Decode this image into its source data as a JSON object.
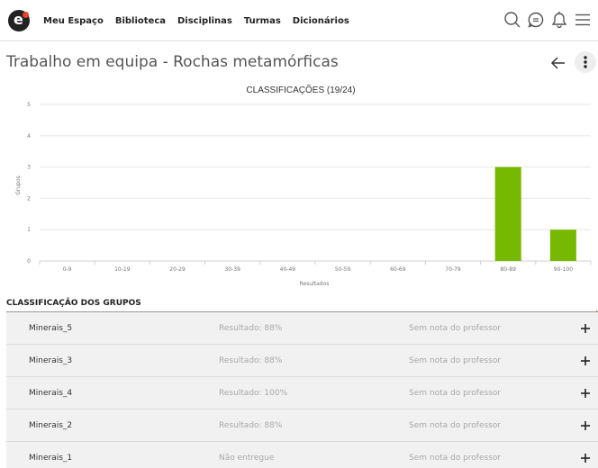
{
  "nav": {
    "logo_letter": "e",
    "items": [
      "Meu Espaço",
      "Biblioteca",
      "Disciplinas",
      "Turmas",
      "Dicionários"
    ],
    "icons": [
      "search-icon",
      "chat-icon",
      "bell-icon",
      "menu-icon"
    ]
  },
  "page": {
    "title": "Trabalho em equipa - Rochas metamórficas",
    "back_icon": "arrow-left-icon",
    "more_icon": "more-vertical-icon"
  },
  "colors": {
    "bar": "#76b900",
    "logo_dot": "#e8422e",
    "row_bg": "#f1f1f1"
  },
  "chart_data": {
    "type": "bar",
    "title": "CLASSIFICAÇÕES (19/24)",
    "xlabel": "Resultados",
    "ylabel": "Grupos",
    "categories": [
      "0-9",
      "10-19",
      "20-29",
      "30-39",
      "40-49",
      "50-59",
      "60-69",
      "70-79",
      "80-89",
      "90-100"
    ],
    "values": [
      0,
      0,
      0,
      0,
      0,
      0,
      0,
      0,
      3,
      1
    ],
    "ylim": [
      0,
      5
    ],
    "yticks": [
      0,
      1,
      2,
      3,
      4,
      5
    ],
    "grid": true
  },
  "ranking": {
    "title": "CLASSIFICAÇÃO DOS GRUPOS",
    "rows": [
      {
        "name": "Minerais_5",
        "result": "Resultado: 88%",
        "note": "Sem nota do professor"
      },
      {
        "name": "Minerais_3",
        "result": "Resultado: 88%",
        "note": "Sem nota do professor"
      },
      {
        "name": "Minerais_4",
        "result": "Resultado: 100%",
        "note": "Sem nota do professor"
      },
      {
        "name": "Minerais_2",
        "result": "Resultado: 88%",
        "note": "Sem nota do professor"
      },
      {
        "name": "Minerais_1",
        "result": "Não entregue",
        "note": "Sem nota do professor"
      }
    ],
    "add_icon": "plus-icon"
  }
}
